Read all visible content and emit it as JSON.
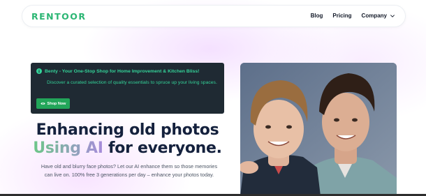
{
  "brand": {
    "logo": "RENTOOR",
    "accent": "#2bb673"
  },
  "nav": {
    "links": [
      {
        "label": "Blog"
      },
      {
        "label": "Pricing"
      },
      {
        "label": "Company",
        "dropdown": true,
        "icon": "chevron-down-icon"
      }
    ]
  },
  "banner": {
    "icon": "info-icon",
    "title": "Benty - Your One-Stop Shop for Home Improvement & Kitchen Bliss!",
    "description": "Discover a curated selection of quality essentials to spruce up your living spaces.",
    "button": {
      "label": "Shop Now",
      "icon": "eye-icon",
      "color": "#22a559"
    },
    "background": "#1f2a33",
    "text_color": "#34d399"
  },
  "hero": {
    "line1": "Enhancing old photos",
    "highlight": "Using AI",
    "line2_rest": " for everyone.",
    "description": "Have old and blurry face photos? Let our AI enhance them so those memories can live on. 100% free 3 generations per day – enhance your photos today."
  }
}
